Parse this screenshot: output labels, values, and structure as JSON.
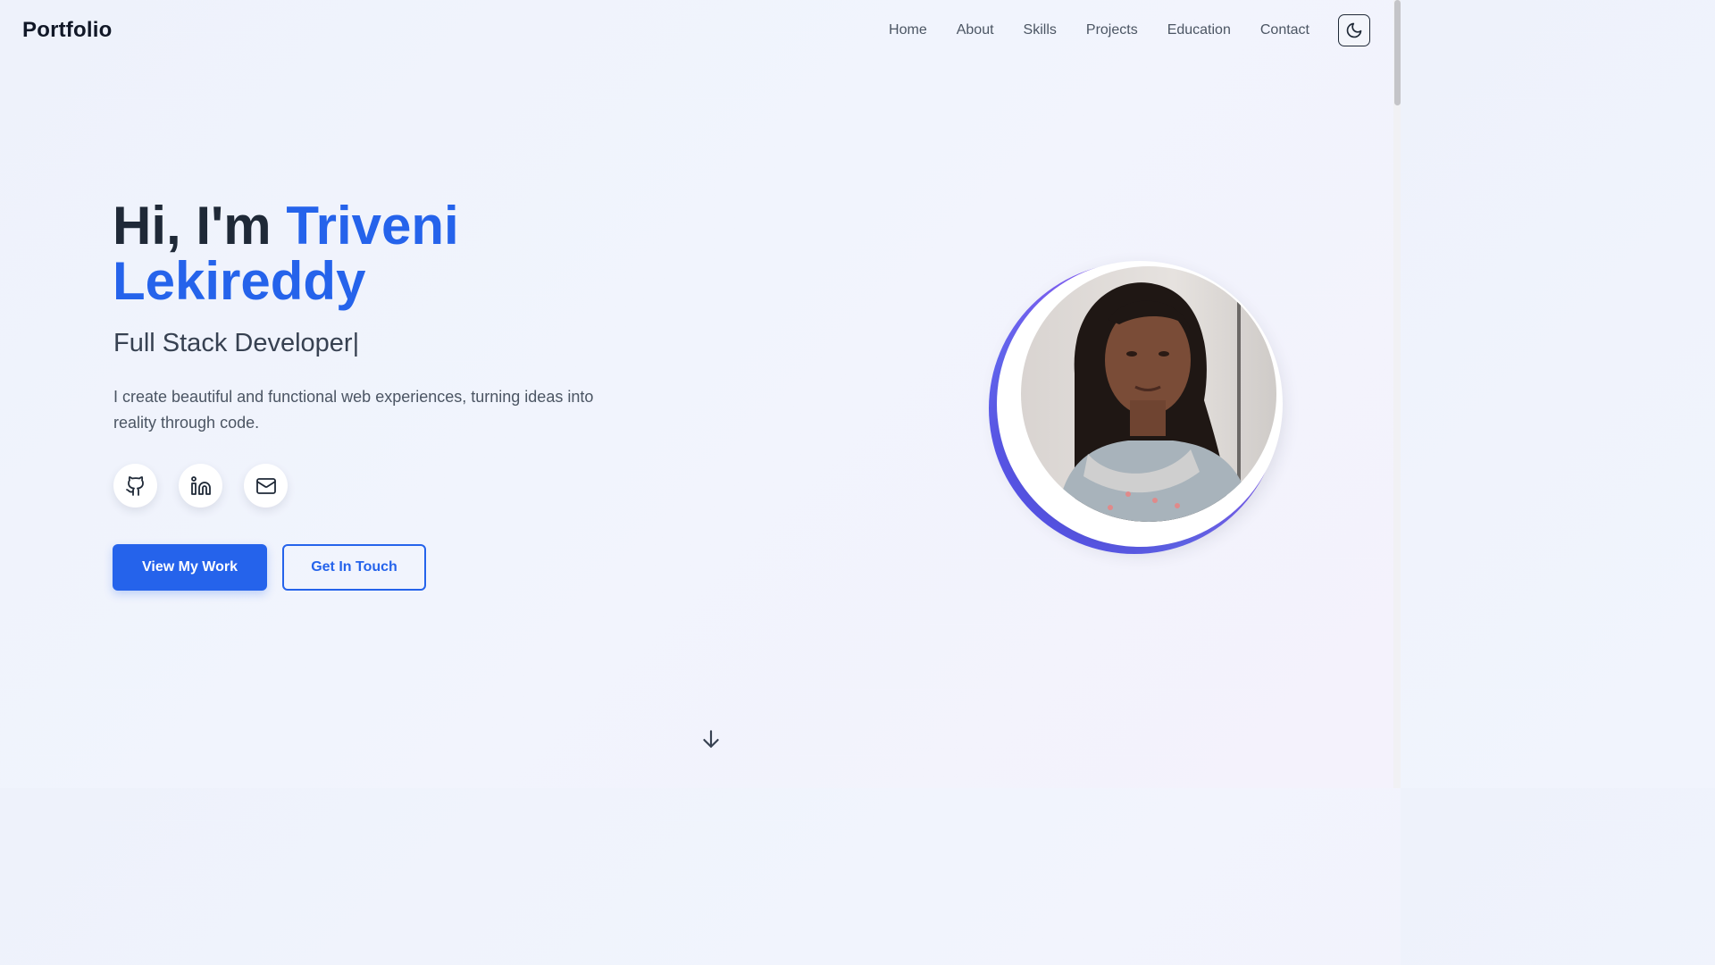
{
  "navbar": {
    "brand": "Portfolio",
    "links": [
      "Home",
      "About",
      "Skills",
      "Projects",
      "Education",
      "Contact"
    ],
    "theme_toggle_icon": "moon-icon"
  },
  "hero": {
    "greeting": "Hi, I'm",
    "name": "Triveni Lekireddy",
    "role": "Full Stack Developer",
    "cursor": "|",
    "tagline": "I create beautiful and functional web experiences, turning ideas into reality through code.",
    "socials": [
      {
        "icon": "github-icon"
      },
      {
        "icon": "linkedin-icon"
      },
      {
        "icon": "mail-icon"
      }
    ],
    "primary_button": "View My Work",
    "secondary_button": "Get In Touch",
    "scroll_icon": "arrow-down-icon"
  },
  "colors": {
    "accent": "#2563eb",
    "ring_start": "#4f46e5",
    "ring_end": "#a855f7"
  }
}
